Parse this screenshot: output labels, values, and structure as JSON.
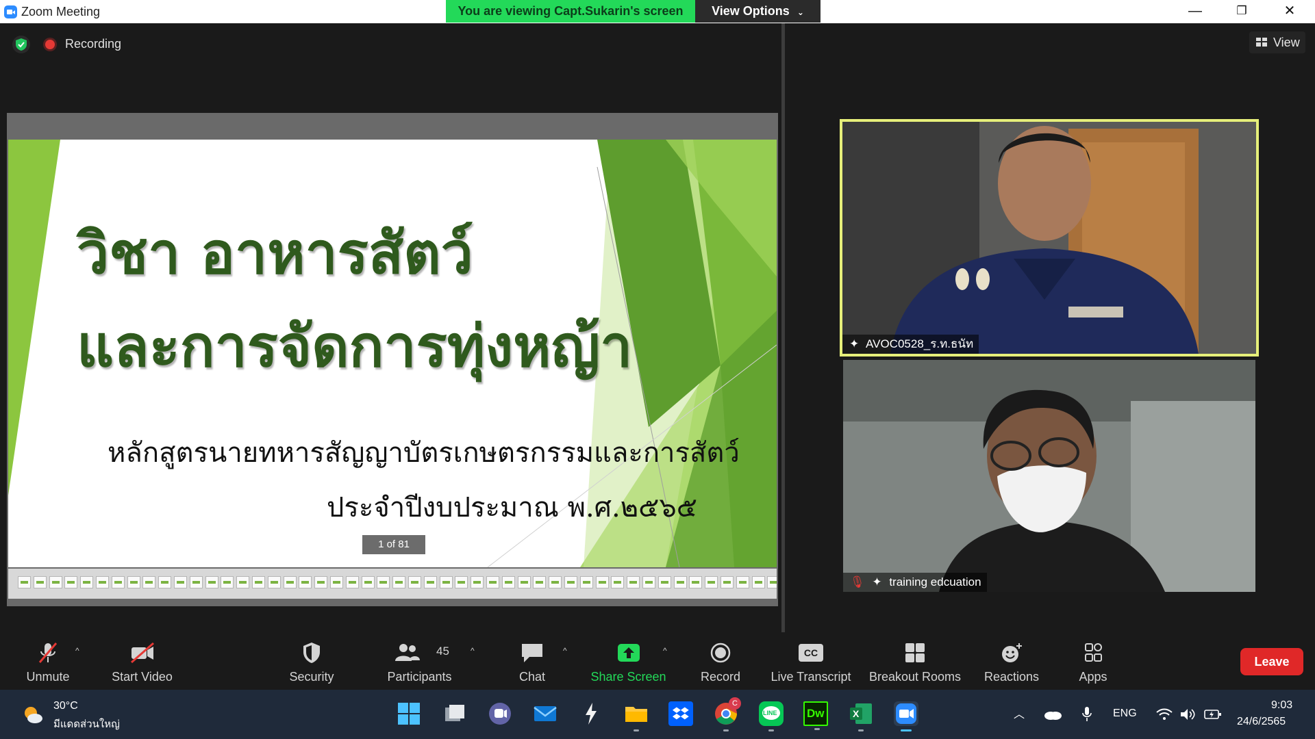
{
  "window": {
    "title": "Zoom Meeting",
    "viewing_banner": "You are viewing Capt.Sukarin's screen",
    "view_options": "View Options",
    "controls": {
      "minimize": "—",
      "restore": "❐",
      "close": "✕"
    }
  },
  "meeting": {
    "recording_label": "Recording",
    "view_label": "View"
  },
  "slide": {
    "title_line1": "วิชา อาหารสัตว์",
    "title_line2": "และการจัดการทุ่งหญ้า",
    "subtitle_line1": "หลักสูตรนายทหารสัญญาบัตรเกษตรกรรมและการสัตว์",
    "subtitle_line2": "ประจำปีงบประมาณ พ.ศ.๒๕๖๕",
    "counter": "1 of 81"
  },
  "participants_video": [
    {
      "name": "AVOC0528_ร.ท.ธนัท",
      "active_speaker": true
    },
    {
      "name": "training edcuation",
      "muted": true
    }
  ],
  "toolbar": {
    "unmute": "Unmute",
    "start_video": "Start Video",
    "security": "Security",
    "participants": "Participants",
    "participants_count": "45",
    "chat": "Chat",
    "share_screen": "Share Screen",
    "record": "Record",
    "live_transcript": "Live Transcript",
    "breakout_rooms": "Breakout Rooms",
    "reactions": "Reactions",
    "apps": "Apps",
    "leave": "Leave",
    "cc": "CC"
  },
  "taskbar": {
    "weather_temp": "30°C",
    "weather_desc": "มีแดดส่วนใหญ่",
    "chrome_badge": "C",
    "dreamweaver_label": "Dw",
    "excel_label": "X",
    "line_label": "LINE",
    "language": "ENG",
    "time": "9:03",
    "date": "24/6/2565"
  },
  "colors": {
    "share_green": "#23d959",
    "leave_red": "#e02828",
    "slide_title_green": "#2f5a1d",
    "active_speaker_border": "#e6ef7a"
  }
}
